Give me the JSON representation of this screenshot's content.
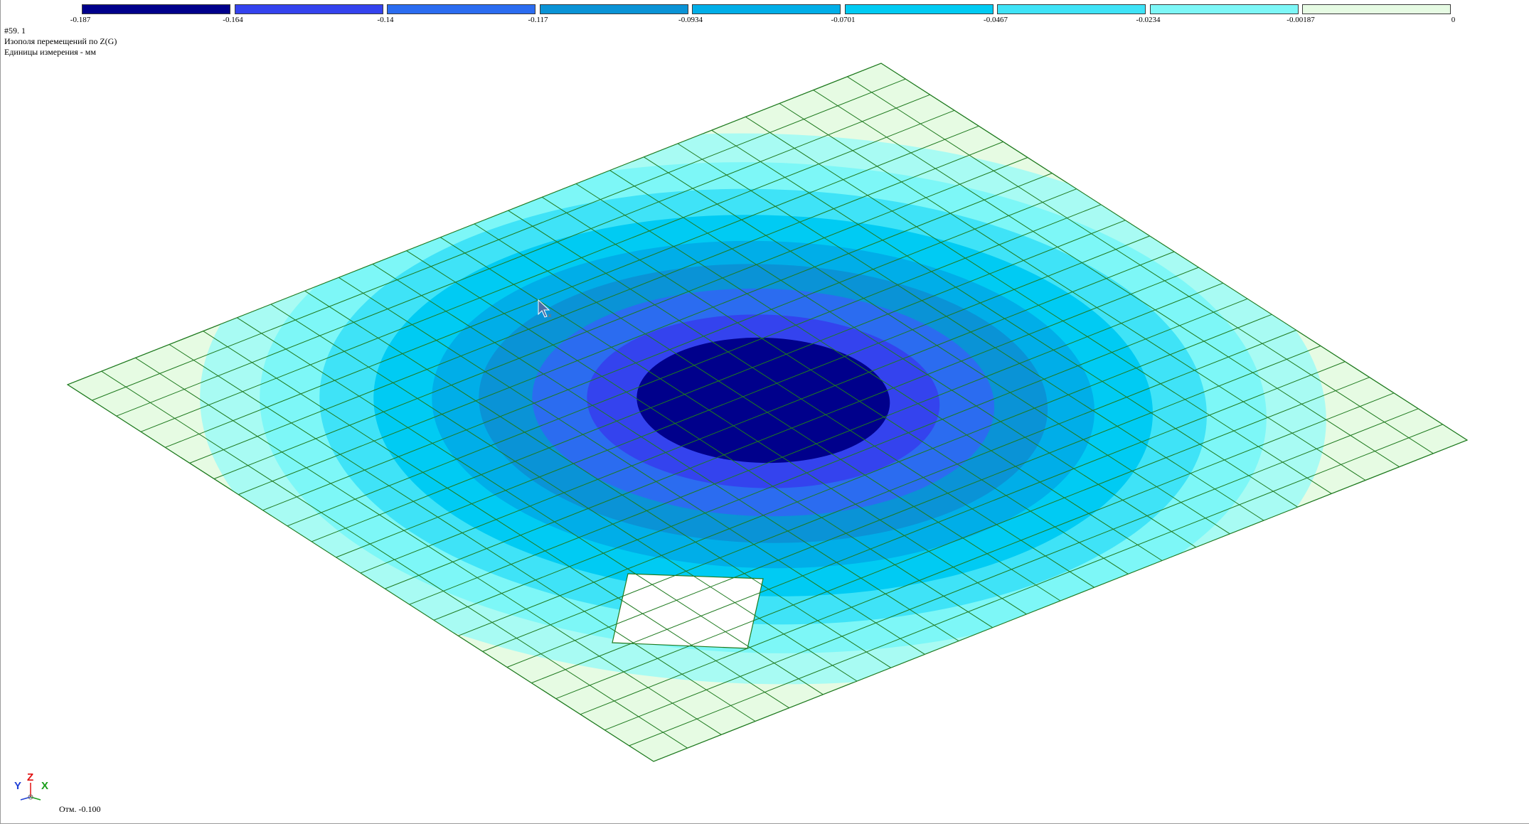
{
  "legend": {
    "colors": [
      "#00008b",
      "#3443ee",
      "#2b6cf0",
      "#0a93d6",
      "#00aee8",
      "#00cbf3",
      "#3fe3f7",
      "#7df7f7",
      "#e6fbe3"
    ],
    "ticks": [
      "-0.187",
      "-0.164",
      "-0.14",
      "-0.117",
      "-0.0934",
      "-0.0701",
      "-0.0467",
      "-0.0234",
      "-0.00187",
      "0"
    ]
  },
  "info": {
    "line1": "#59. 1",
    "line2": "Изополя  перемещений по Z(G)",
    "line3": "Единицы измерения - мм"
  },
  "plate": {
    "grid_color": "#1f7a1f",
    "background_color": "#e6fbe3",
    "contour_levels": 9
  },
  "axes": {
    "x_label": "X",
    "y_label": "Y",
    "z_label": "Z",
    "x_color": "#1a9e1a",
    "y_color": "#1f3fd6",
    "z_color": "#e01010"
  },
  "status": {
    "elevation": "Отм. -0.100"
  }
}
